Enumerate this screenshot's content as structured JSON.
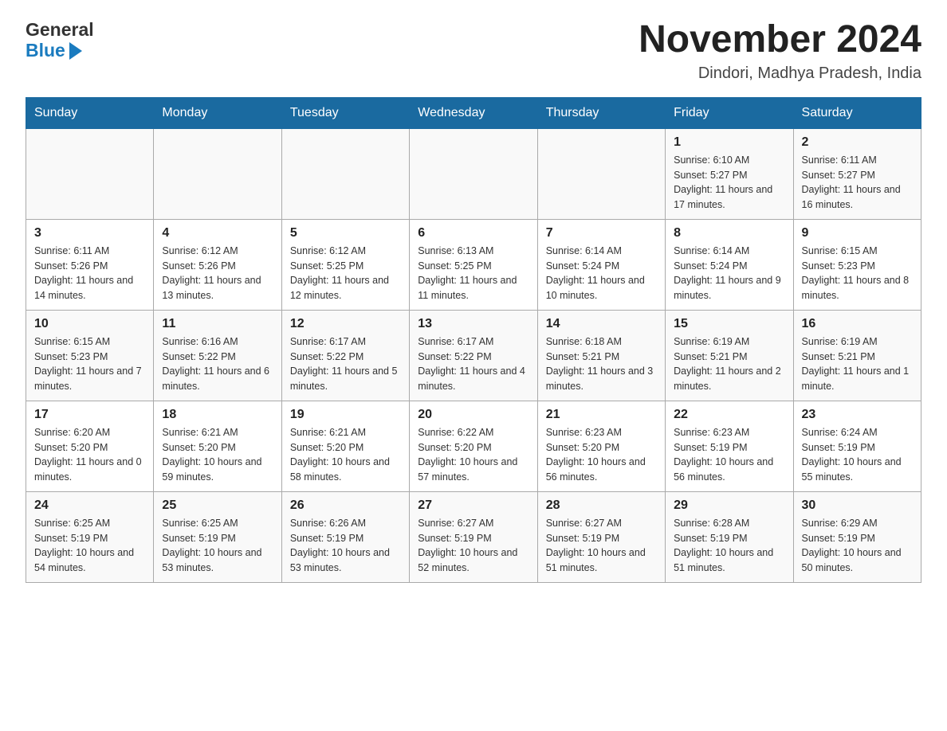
{
  "header": {
    "logo_line1": "General",
    "logo_line2": "Blue",
    "month_title": "November 2024",
    "location": "Dindori, Madhya Pradesh, India"
  },
  "weekdays": [
    "Sunday",
    "Monday",
    "Tuesday",
    "Wednesday",
    "Thursday",
    "Friday",
    "Saturday"
  ],
  "weeks": [
    [
      {
        "day": "",
        "info": ""
      },
      {
        "day": "",
        "info": ""
      },
      {
        "day": "",
        "info": ""
      },
      {
        "day": "",
        "info": ""
      },
      {
        "day": "",
        "info": ""
      },
      {
        "day": "1",
        "info": "Sunrise: 6:10 AM\nSunset: 5:27 PM\nDaylight: 11 hours and 17 minutes."
      },
      {
        "day": "2",
        "info": "Sunrise: 6:11 AM\nSunset: 5:27 PM\nDaylight: 11 hours and 16 minutes."
      }
    ],
    [
      {
        "day": "3",
        "info": "Sunrise: 6:11 AM\nSunset: 5:26 PM\nDaylight: 11 hours and 14 minutes."
      },
      {
        "day": "4",
        "info": "Sunrise: 6:12 AM\nSunset: 5:26 PM\nDaylight: 11 hours and 13 minutes."
      },
      {
        "day": "5",
        "info": "Sunrise: 6:12 AM\nSunset: 5:25 PM\nDaylight: 11 hours and 12 minutes."
      },
      {
        "day": "6",
        "info": "Sunrise: 6:13 AM\nSunset: 5:25 PM\nDaylight: 11 hours and 11 minutes."
      },
      {
        "day": "7",
        "info": "Sunrise: 6:14 AM\nSunset: 5:24 PM\nDaylight: 11 hours and 10 minutes."
      },
      {
        "day": "8",
        "info": "Sunrise: 6:14 AM\nSunset: 5:24 PM\nDaylight: 11 hours and 9 minutes."
      },
      {
        "day": "9",
        "info": "Sunrise: 6:15 AM\nSunset: 5:23 PM\nDaylight: 11 hours and 8 minutes."
      }
    ],
    [
      {
        "day": "10",
        "info": "Sunrise: 6:15 AM\nSunset: 5:23 PM\nDaylight: 11 hours and 7 minutes."
      },
      {
        "day": "11",
        "info": "Sunrise: 6:16 AM\nSunset: 5:22 PM\nDaylight: 11 hours and 6 minutes."
      },
      {
        "day": "12",
        "info": "Sunrise: 6:17 AM\nSunset: 5:22 PM\nDaylight: 11 hours and 5 minutes."
      },
      {
        "day": "13",
        "info": "Sunrise: 6:17 AM\nSunset: 5:22 PM\nDaylight: 11 hours and 4 minutes."
      },
      {
        "day": "14",
        "info": "Sunrise: 6:18 AM\nSunset: 5:21 PM\nDaylight: 11 hours and 3 minutes."
      },
      {
        "day": "15",
        "info": "Sunrise: 6:19 AM\nSunset: 5:21 PM\nDaylight: 11 hours and 2 minutes."
      },
      {
        "day": "16",
        "info": "Sunrise: 6:19 AM\nSunset: 5:21 PM\nDaylight: 11 hours and 1 minute."
      }
    ],
    [
      {
        "day": "17",
        "info": "Sunrise: 6:20 AM\nSunset: 5:20 PM\nDaylight: 11 hours and 0 minutes."
      },
      {
        "day": "18",
        "info": "Sunrise: 6:21 AM\nSunset: 5:20 PM\nDaylight: 10 hours and 59 minutes."
      },
      {
        "day": "19",
        "info": "Sunrise: 6:21 AM\nSunset: 5:20 PM\nDaylight: 10 hours and 58 minutes."
      },
      {
        "day": "20",
        "info": "Sunrise: 6:22 AM\nSunset: 5:20 PM\nDaylight: 10 hours and 57 minutes."
      },
      {
        "day": "21",
        "info": "Sunrise: 6:23 AM\nSunset: 5:20 PM\nDaylight: 10 hours and 56 minutes."
      },
      {
        "day": "22",
        "info": "Sunrise: 6:23 AM\nSunset: 5:19 PM\nDaylight: 10 hours and 56 minutes."
      },
      {
        "day": "23",
        "info": "Sunrise: 6:24 AM\nSunset: 5:19 PM\nDaylight: 10 hours and 55 minutes."
      }
    ],
    [
      {
        "day": "24",
        "info": "Sunrise: 6:25 AM\nSunset: 5:19 PM\nDaylight: 10 hours and 54 minutes."
      },
      {
        "day": "25",
        "info": "Sunrise: 6:25 AM\nSunset: 5:19 PM\nDaylight: 10 hours and 53 minutes."
      },
      {
        "day": "26",
        "info": "Sunrise: 6:26 AM\nSunset: 5:19 PM\nDaylight: 10 hours and 53 minutes."
      },
      {
        "day": "27",
        "info": "Sunrise: 6:27 AM\nSunset: 5:19 PM\nDaylight: 10 hours and 52 minutes."
      },
      {
        "day": "28",
        "info": "Sunrise: 6:27 AM\nSunset: 5:19 PM\nDaylight: 10 hours and 51 minutes."
      },
      {
        "day": "29",
        "info": "Sunrise: 6:28 AM\nSunset: 5:19 PM\nDaylight: 10 hours and 51 minutes."
      },
      {
        "day": "30",
        "info": "Sunrise: 6:29 AM\nSunset: 5:19 PM\nDaylight: 10 hours and 50 minutes."
      }
    ]
  ]
}
